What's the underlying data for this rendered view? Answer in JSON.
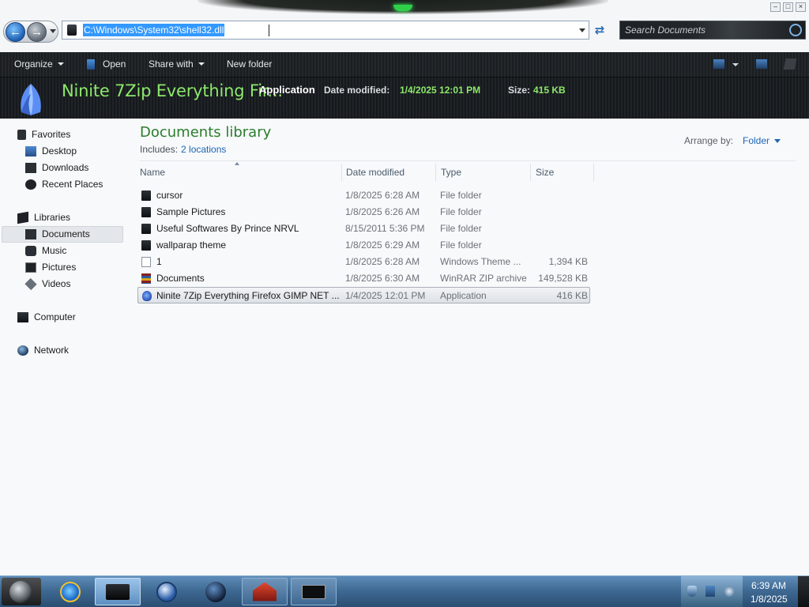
{
  "window": {
    "address_path": "C:\\Windows\\System32\\shell32.dll",
    "search_placeholder": "Search Documents",
    "controls": [
      "minimize",
      "maximize",
      "close"
    ]
  },
  "toolbar": {
    "organize": "Organize",
    "open": "Open",
    "share_with": "Share with",
    "new_folder": "New folder"
  },
  "details": {
    "name": "Ninite 7Zip Everything Fir...",
    "type": "Application",
    "modified_label": "Date modified:",
    "modified_value": "1/4/2025 12:01 PM",
    "size_label": "Size:",
    "size_value": "415 KB"
  },
  "navigation": {
    "favorites": "Favorites",
    "desktop": "Desktop",
    "downloads": "Downloads",
    "recent": "Recent Places",
    "libraries": "Libraries",
    "documents": "Documents",
    "music": "Music",
    "pictures": "Pictures",
    "videos": "Videos",
    "computer": "Computer",
    "network": "Network"
  },
  "library": {
    "title": "Documents library",
    "includes_label": "Includes:",
    "includes_link": "2 locations",
    "arrange_label": "Arrange by:",
    "arrange_value": "Folder"
  },
  "columns": {
    "name": "Name",
    "date": "Date modified",
    "type": "Type",
    "size": "Size"
  },
  "files": [
    {
      "name": "cursor",
      "date": "1/8/2025 6:28 AM",
      "type": "File folder",
      "size": "",
      "icon": "folder-icon"
    },
    {
      "name": "Sample Pictures",
      "date": "1/8/2025 6:26 AM",
      "type": "File folder",
      "size": "",
      "icon": "folder-icon"
    },
    {
      "name": "Useful Softwares By Prince NRVL",
      "date": "8/15/2011 5:36 PM",
      "type": "File folder",
      "size": "",
      "icon": "folder-icon"
    },
    {
      "name": "wallparap theme",
      "date": "1/8/2025 6:29 AM",
      "type": "File folder",
      "size": "",
      "icon": "folder-icon"
    },
    {
      "name": "1",
      "date": "1/8/2025 6:28 AM",
      "type": "Windows Theme ...",
      "size": "1,394 KB",
      "icon": "theme-file-icon"
    },
    {
      "name": "Documents",
      "date": "1/8/2025 6:30 AM",
      "type": "WinRAR ZIP archive",
      "size": "149,528 KB",
      "icon": "zip-archive-icon"
    },
    {
      "name": "Ninite 7Zip Everything Firefox GIMP NET ...",
      "date": "1/4/2025 12:01 PM",
      "type": "Application",
      "size": "416 KB",
      "icon": "application-icon",
      "selected": true
    }
  ],
  "taskbar": {
    "apps": [
      "internet-explorer",
      "windows-explorer",
      "media-player",
      "globe-app",
      "red-app",
      "terminal-app"
    ],
    "clock_time": "6:39 AM",
    "clock_date": "1/8/2025"
  },
  "colors": {
    "accent_green": "#8de86b",
    "library_title": "#2c7d2c",
    "link_blue": "#1c65b5",
    "selection_blue": "#3399ff"
  }
}
